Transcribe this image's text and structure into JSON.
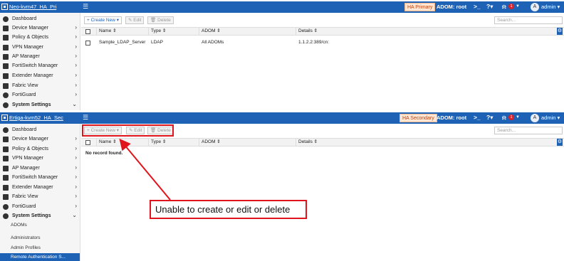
{
  "primary": {
    "device_name": "Neo-kvm47_HA_Pri",
    "ha_status": "HA Primary",
    "adom": "ADOM: root",
    "user": "admin",
    "avatar_letter": "A",
    "notifications": "1",
    "nav": [
      {
        "label": "Dashboard",
        "icon": "dashboard-icon",
        "chevron": ""
      },
      {
        "label": "Device Manager",
        "icon": "device-manager-icon",
        "chevron": "›"
      },
      {
        "label": "Policy & Objects",
        "icon": "policy-objects-icon",
        "chevron": "›"
      },
      {
        "label": "VPN Manager",
        "icon": "vpn-manager-icon",
        "chevron": "›"
      },
      {
        "label": "AP Manager",
        "icon": "ap-manager-icon",
        "chevron": "›"
      },
      {
        "label": "FortiSwitch Manager",
        "icon": "fortiswitch-manager-icon",
        "chevron": "›"
      },
      {
        "label": "Extender Manager",
        "icon": "extender-manager-icon",
        "chevron": "›"
      },
      {
        "label": "Fabric View",
        "icon": "fabric-view-icon",
        "chevron": "›"
      },
      {
        "label": "FortiGuard",
        "icon": "fortiguard-icon",
        "chevron": "›"
      },
      {
        "label": "System Settings",
        "icon": "system-settings-icon",
        "chevron": "⌄"
      }
    ],
    "toolbar": {
      "create_new": "+ Create New ▾",
      "edit": "Edit",
      "delete": "Delete",
      "search_placeholder": "Search..."
    },
    "columns": [
      "Name",
      "Type",
      "ADOM",
      "Details"
    ],
    "rows": [
      {
        "name": "Sample_LDAP_Server",
        "type": "LDAP",
        "adom": "All ADOMs",
        "details": "1.1.2.2:389/cn:"
      }
    ]
  },
  "secondary": {
    "device_name": "Ertiga-kvm52_HA_Sec",
    "ha_status": "HA Secondary",
    "adom": "ADOM: root",
    "user": "admin",
    "avatar_letter": "A",
    "notifications": "1",
    "nav": [
      {
        "label": "Dashboard",
        "icon": "dashboard-icon",
        "chevron": ""
      },
      {
        "label": "Device Manager",
        "icon": "device-manager-icon",
        "chevron": "›"
      },
      {
        "label": "Policy & Objects",
        "icon": "policy-objects-icon",
        "chevron": "›"
      },
      {
        "label": "VPN Manager",
        "icon": "vpn-manager-icon",
        "chevron": "›"
      },
      {
        "label": "AP Manager",
        "icon": "ap-manager-icon",
        "chevron": "›"
      },
      {
        "label": "FortiSwitch Manager",
        "icon": "fortiswitch-manager-icon",
        "chevron": "›"
      },
      {
        "label": "Extender Manager",
        "icon": "extender-manager-icon",
        "chevron": "›"
      },
      {
        "label": "Fabric View",
        "icon": "fabric-view-icon",
        "chevron": "›"
      },
      {
        "label": "FortiGuard",
        "icon": "fortiguard-icon",
        "chevron": "›"
      },
      {
        "label": "System Settings",
        "icon": "system-settings-icon",
        "chevron": "⌄"
      }
    ],
    "subnav": [
      "ADOMs",
      "Administrators",
      "Admin Profiles",
      "Remote Authentication S..."
    ],
    "toolbar": {
      "create_new": "+ Create New ▾",
      "edit": "Edit",
      "delete": "Delete",
      "search_placeholder": "Search..."
    },
    "columns": [
      "Name",
      "Type",
      "ADOM",
      "Details"
    ],
    "empty_message": "No record found."
  },
  "annotation": {
    "text": "Unable to create or edit or delete",
    "color": "#e0141c"
  },
  "colors": {
    "topbar": "#1e62b6",
    "accent": "#1e62b6",
    "ha_badge_bg": "#fde7d4",
    "ha_badge_text": "#c2410c"
  }
}
